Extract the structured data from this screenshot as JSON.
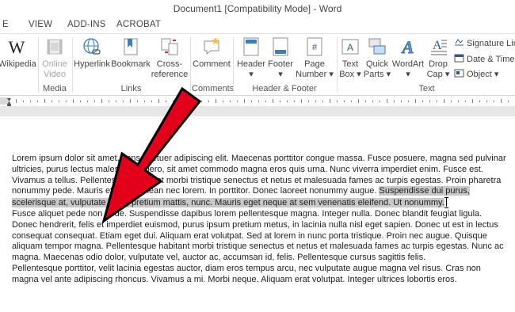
{
  "window": {
    "title": "Document1 [Compatibility Mode] - Word"
  },
  "tabs": [
    "E",
    "VIEW",
    "ADD-INS",
    "ACROBAT"
  ],
  "ribbon": {
    "buttons": {
      "wikipedia": "Wikipedia",
      "online_video": [
        "Online",
        "Video"
      ],
      "hyperlink": "Hyperlink",
      "bookmark": "Bookmark",
      "cross_reference": [
        "Cross-",
        "reference"
      ],
      "comment": "Comment",
      "header": [
        "Header",
        "▾"
      ],
      "footer": [
        "Footer",
        "▾"
      ],
      "page_number": [
        "Page",
        "Number ▾"
      ],
      "text_box": [
        "Text",
        "Box ▾"
      ],
      "quick_parts": [
        "Quick",
        "Parts ▾"
      ],
      "wordart": [
        "WordArt",
        "▾"
      ],
      "drop_cap": [
        "Drop",
        "Cap ▾"
      ],
      "signature_line": "Signature Line",
      "date_time": "Date & Time",
      "object": "Object ▾"
    },
    "groups": {
      "media": "Media",
      "links": "Links",
      "comments": "Comments",
      "header_footer": "Header & Footer",
      "text": "Text"
    }
  },
  "document": {
    "p1_before": "Lorem ipsum dolor sit amet, consectetuer adipiscing elit. Maecenas porttitor congue massa. Fusce posuere, magna sed pulvinar ultricies, purus lectus malesuada libero, sit amet commodo magna eros quis urna. Nunc viverra imperdiet enim. Fusce est. Vivamus a tellus. Pellentesque habitant morbi tristique senectus et netus et malesuada fames ac turpis egestas. Proin pharetra nonummy pede. Mauris et orci. Aenean nec lorem. In porttitor. Donec laoreet nonummy augue.",
    "p1_selected": "Suspendisse dui purus, scelerisque at, vulputate vitae, pretium mattis, nunc. Mauris eget neque at sem venenatis eleifend. Ut nonummy.",
    "p2": "Fusce aliquet pede non pede. Suspendisse dapibus lorem pellentesque magna. Integer nulla. Donec blandit feugiat ligula. Donec hendrerit, felis et imperdiet euismod, purus ipsum pretium metus, in lacinia nulla nisl eget sapien. Donec ut est in lectus consequat consequat. Etiam eget dui. Aliquam erat volutpat. Sed at lorem in nunc porta tristique. Proin nec augue. Quisque aliquam tempor magna. Pellentesque habitant morbi tristique senectus et netus et malesuada fames ac turpis egestas. Nunc ac magna. Maecenas odio dolor, vulputate vel, auctor ac, accumsan id, felis. Pellentesque cursus sagittis felis.",
    "p3": "Pellentesque porttitor, velit lacinia egestas auctor, diam eros tempus arcu, nec vulputate augue magna vel risus. Cras non magna vel ante adipiscing rhoncus. Vivamus a mi. Morbi neque. Aliquam erat volutpat. Integer ultrices lobortis eros."
  },
  "colors": {
    "arrow": "#e2001a",
    "selection": "#c8c8c8",
    "accent": "#2b579a"
  }
}
